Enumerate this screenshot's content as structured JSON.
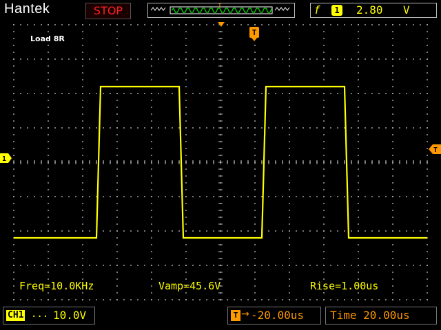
{
  "header": {
    "brand": "Hantek",
    "run_state": "STOP",
    "trigger": {
      "edge_symbol": "f",
      "source": "1",
      "level": "2.80",
      "unit": "V"
    }
  },
  "screen": {
    "note": "Load 8R",
    "markers": {
      "trigger_top": "T",
      "channel_left": "1"
    },
    "measurements": {
      "freq": "Freq=10.0KHz",
      "vamp": "Vamp=45.6V",
      "rise": "Rise=1.00us"
    }
  },
  "footer": {
    "channel": {
      "tag": "CH1",
      "coupling_symbol": "...",
      "scale": "10.0V"
    },
    "trigger_position": {
      "icon": "T",
      "arrow": "→",
      "value": "-20.00us"
    },
    "timebase": {
      "value": "Time 20.00us"
    }
  },
  "colors": {
    "trace": "#ffff00",
    "trigger_accent": "#ff9900",
    "stop": "#ff2020",
    "grid": "#bfbfbf"
  },
  "chart_data": {
    "type": "line",
    "title": "",
    "xlabel": "",
    "ylabel": "",
    "series": [
      {
        "values": [
          [
            0,
            -1.1
          ],
          [
            1.0,
            -1.1
          ],
          [
            1.05,
            1.1
          ],
          [
            2.0,
            1.1
          ],
          [
            2.05,
            -1.1
          ],
          [
            3.0,
            -1.1
          ],
          [
            3.05,
            1.1
          ],
          [
            4.0,
            1.1
          ],
          [
            4.05,
            -1.1
          ],
          [
            5.0,
            -1.1
          ]
        ]
      }
    ],
    "xlim": [
      0,
      5
    ],
    "ylim": [
      -2,
      2
    ],
    "grid": true
  }
}
